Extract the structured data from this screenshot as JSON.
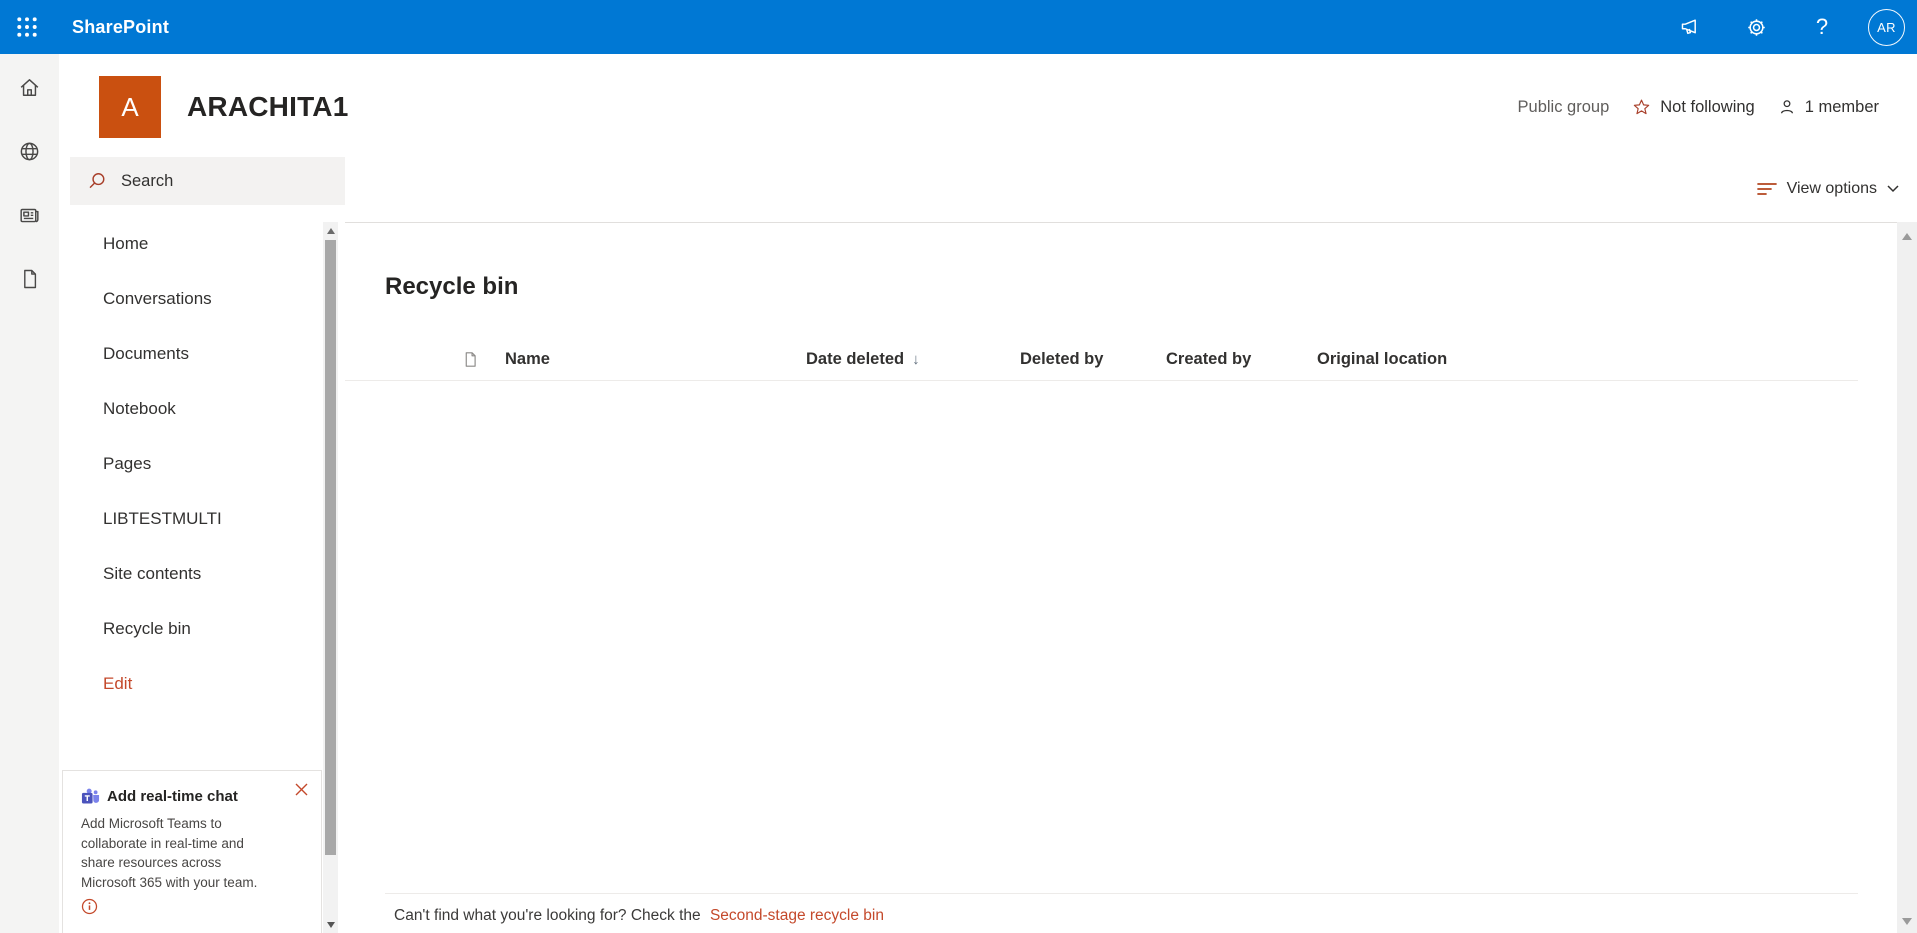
{
  "topbar": {
    "brand": "SharePoint",
    "help_label": "?",
    "avatar_initials": "AR"
  },
  "site": {
    "logo_letter": "A",
    "title": "ARACHITA1",
    "group_type": "Public group",
    "follow_label": "Not following",
    "members_label": "1 member"
  },
  "toolbar": {
    "search_placeholder": "Search",
    "view_options_label": "View options"
  },
  "sidebar": {
    "items": [
      "Home",
      "Conversations",
      "Documents",
      "Notebook",
      "Pages",
      "LIBTESTMULTI",
      "Site contents",
      "Recycle bin",
      "Edit"
    ],
    "promo": {
      "title": "Add real-time chat",
      "body": "Add Microsoft Teams to collaborate in real-time and share resources across Microsoft 365 with your team."
    }
  },
  "main": {
    "page_title": "Recycle bin",
    "table": {
      "columns": [
        "Name",
        "Date deleted",
        "Deleted by",
        "Created by",
        "Original location"
      ],
      "sort_column": "Date deleted",
      "sort_direction": "descending",
      "sort_arrow": "↓",
      "rows": []
    },
    "footer": {
      "text": "Can't find what you're looking for? Check the",
      "link": "Second-stage recycle bin"
    }
  },
  "colors": {
    "topbar_blue": "#0078d4",
    "accent": "#c4492b",
    "accent_icon": "#a83f2a",
    "teams_purple": "#4b53bc"
  }
}
